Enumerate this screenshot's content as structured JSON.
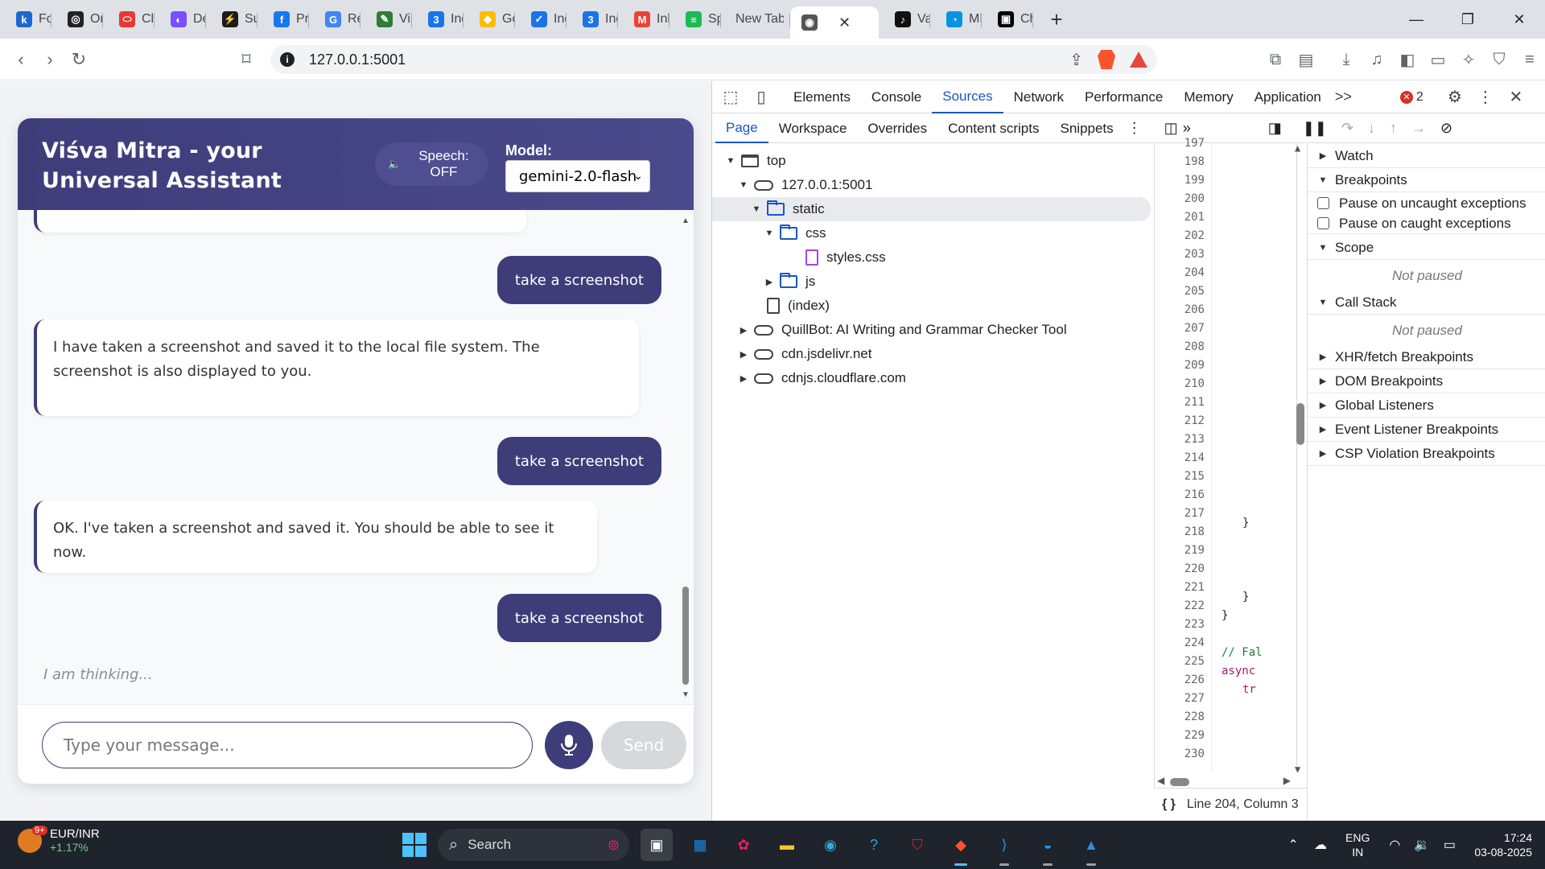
{
  "browser": {
    "tabs": [
      {
        "title": "Fork",
        "favicon": "k",
        "color": "#1f66d1"
      },
      {
        "title": "Oracle",
        "favicon": "◎",
        "color": "#222222"
      },
      {
        "title": "Cloud",
        "favicon": "⬭",
        "color": "#e53935"
      },
      {
        "title": "Deploy",
        "favicon": "◐",
        "color": "#7c4dff"
      },
      {
        "title": "Supabase",
        "favicon": "⚡",
        "color": "#1b1b1b"
      },
      {
        "title": "Pricing",
        "favicon": "f",
        "color": "#1877f2"
      },
      {
        "title": "Reviews",
        "favicon": "G",
        "color": "#4285f4"
      },
      {
        "title": "Vishwa",
        "favicon": "✎",
        "color": "#2e7d32"
      },
      {
        "title": "India",
        "favicon": "3",
        "color": "#1a73e8"
      },
      {
        "title": "Google",
        "favicon": "◆",
        "color": "#fbbc04"
      },
      {
        "title": "India",
        "favicon": "✓",
        "color": "#1a73e8"
      },
      {
        "title": "India",
        "favicon": "3",
        "color": "#1a73e8"
      },
      {
        "title": "Inbox",
        "favicon": "M",
        "color": "#ea4335"
      },
      {
        "title": "Spotify",
        "favicon": "≡",
        "color": "#1db954"
      },
      {
        "title": "New Tab",
        "favicon": "",
        "color": ""
      },
      {
        "title": "",
        "favicon": "◉",
        "color": "#555555"
      },
      {
        "title": "Various",
        "favicon": "♪",
        "color": "#111111"
      },
      {
        "title": "MLflow",
        "favicon": "◔",
        "color": "#0194e2"
      },
      {
        "title": "Chat",
        "favicon": "▣",
        "color": "#000000"
      }
    ],
    "new_tab_symbol": "+",
    "close_symbol": "✕",
    "url": "127.0.0.1:5001"
  },
  "chat": {
    "title": "Viśva Mitra - your Universal Assistant",
    "speech_label": "Speech:",
    "speech_state": "OFF",
    "model_label": "Model:",
    "model_value": "gemini-2.0-flash",
    "messages": {
      "bot1": "I have taken a screenshot and saved it to the local file system. The screenshot is also displayed to you.",
      "bot2": "OK. I've taken a screenshot and saved it. You should be able to see it now.",
      "user1": "take a screenshot",
      "user2": "take a screenshot",
      "user3": "take a screenshot"
    },
    "thinking": "I am thinking...",
    "input_placeholder": "Type your message...",
    "send_label": "Send"
  },
  "devtools": {
    "tabs": [
      "Elements",
      "Console",
      "Sources",
      "Network",
      "Performance",
      "Memory",
      "Application"
    ],
    "active_tab": "Sources",
    "more_symbol": ">>",
    "error_count": "2",
    "subtabs": [
      "Page",
      "Workspace",
      "Overrides",
      "Content scripts",
      "Snippets"
    ],
    "active_subtab": "Page",
    "tree": {
      "top": "top",
      "origin": "127.0.0.1:5001",
      "static": "static",
      "css": "css",
      "styles": "styles.css",
      "js": "js",
      "index": "(index)",
      "quillbot": "QuillBot: AI Writing and Grammar Checker Tool",
      "jsdelivr": "cdn.jsdelivr.net",
      "cloudflare": "cdnjs.cloudflare.com"
    },
    "line_numbers": [
      "197",
      "198",
      "199",
      "200",
      "201",
      "202",
      "203",
      "204",
      "205",
      "206",
      "207",
      "208",
      "209",
      "210",
      "211",
      "212",
      "213",
      "214",
      "215",
      "216",
      "217",
      "218",
      "219",
      "220",
      "221",
      "222",
      "223",
      "224",
      "225",
      "226",
      "227",
      "228",
      "229",
      "230"
    ],
    "code": {
      "l217": "}",
      "l221": "}",
      "l222": "}",
      "l224": "// Fal",
      "l225": "async",
      "l226": "tr"
    },
    "status": "Line 204, Column 3",
    "debugger": {
      "watch": "Watch",
      "breakpoints": "Breakpoints",
      "pause_uncaught": "Pause on uncaught exceptions",
      "pause_caught": "Pause on caught exceptions",
      "scope": "Scope",
      "not_paused_scope": "Not paused",
      "call_stack": "Call Stack",
      "not_paused_stack": "Not paused",
      "xhr": "XHR/fetch Breakpoints",
      "dom": "DOM Breakpoints",
      "global": "Global Listeners",
      "event": "Event Listener Breakpoints",
      "csp": "CSP Violation Breakpoints"
    }
  },
  "taskbar": {
    "widget_title": "EUR/INR",
    "widget_change": "+1.17%",
    "widget_badge": "9+",
    "search_label": "Search",
    "lang_1": "ENG",
    "lang_2": "IN",
    "time": "17:24",
    "date": "03-08-2025"
  }
}
